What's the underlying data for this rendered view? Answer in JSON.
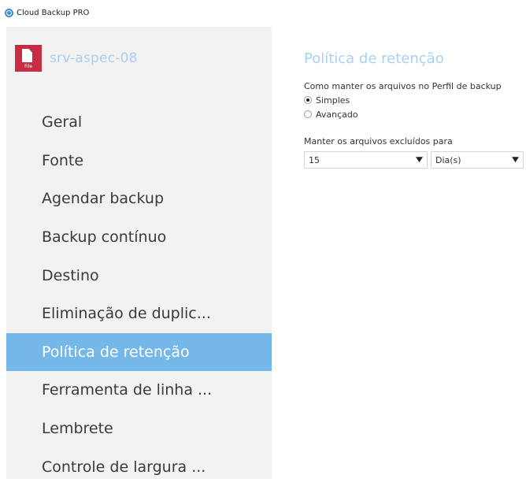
{
  "window": {
    "title": "Cloud Backup PRO"
  },
  "profile": {
    "name": "srv-aspec-08",
    "icon_label": "File",
    "icon": "file-icon"
  },
  "menu": {
    "items": [
      {
        "label": "Geral",
        "active": false
      },
      {
        "label": "Fonte",
        "active": false
      },
      {
        "label": "Agendar backup",
        "active": false
      },
      {
        "label": "Backup contínuo",
        "active": false
      },
      {
        "label": "Destino",
        "active": false
      },
      {
        "label": "Eliminação de duplic...",
        "active": false
      },
      {
        "label": "Política de retenção",
        "active": true
      },
      {
        "label": "Ferramenta de linha ...",
        "active": false
      },
      {
        "label": "Lembrete",
        "active": false
      },
      {
        "label": "Controle de largura ...",
        "active": false
      }
    ]
  },
  "main": {
    "title": "Política de retenção",
    "question": "Como manter os arquivos no Perfil de backup",
    "options": [
      {
        "label": "Simples",
        "checked": true
      },
      {
        "label": "Avançado",
        "checked": false
      }
    ],
    "keep_label": "Manter os arquivos excluídos para",
    "keep_value": "15",
    "keep_unit": "Dia(s)"
  },
  "colors": {
    "accent": "#74b8ea",
    "title_light_blue": "#aad2f0",
    "file_tile": "#c62d42",
    "sidebar_bg": "#f2f2f2"
  }
}
